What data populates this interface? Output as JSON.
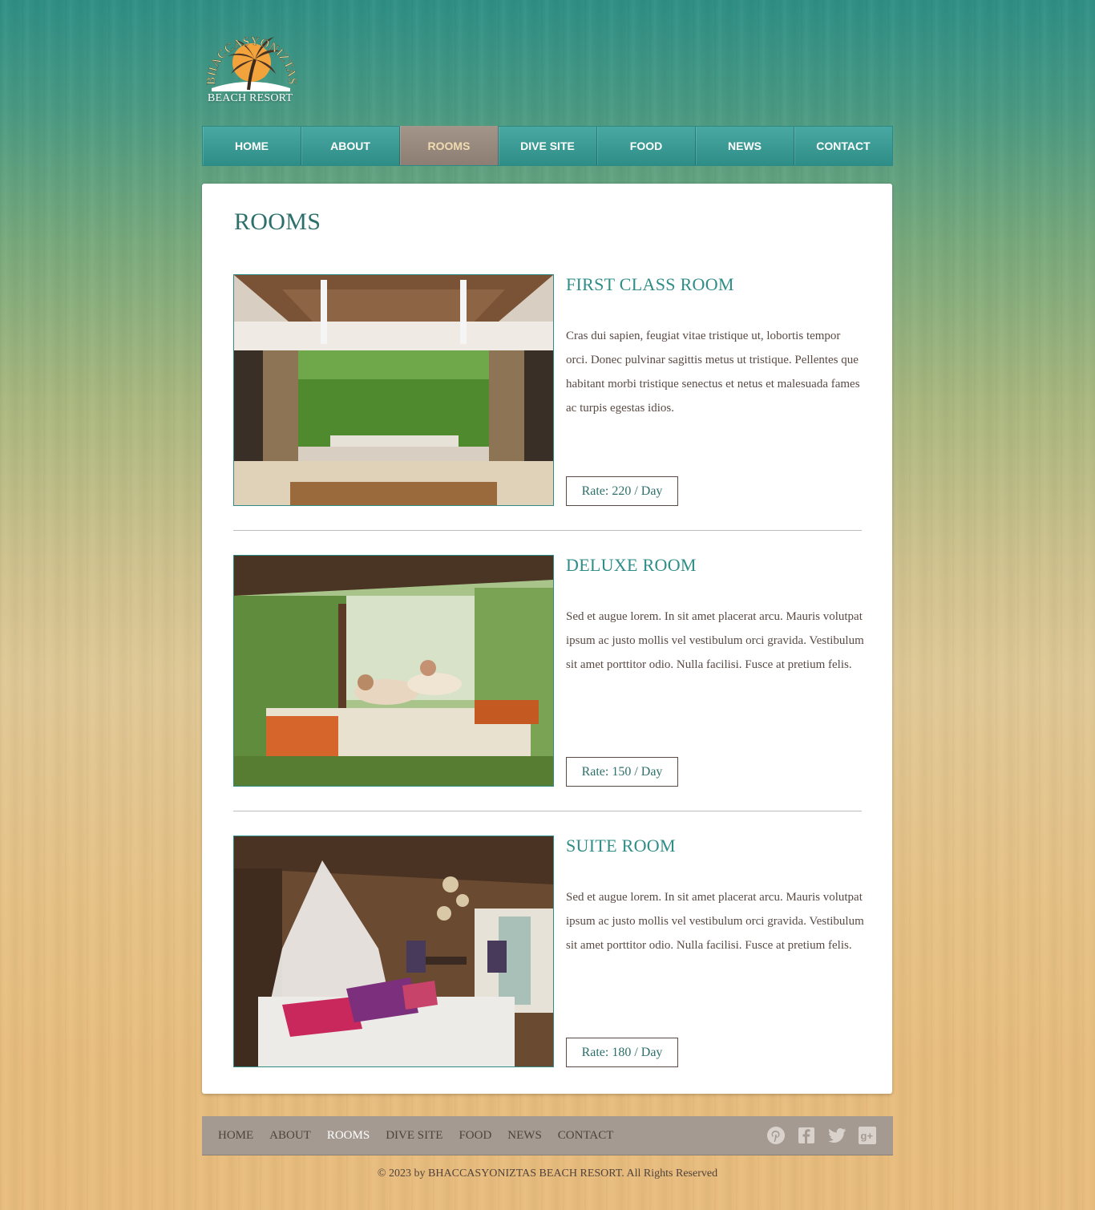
{
  "logo": {
    "arc_text": "BHACCASYONIZTAS",
    "tagline": "BEACH RESORT"
  },
  "nav": {
    "items": [
      {
        "label": "HOME"
      },
      {
        "label": "ABOUT"
      },
      {
        "label": "ROOMS",
        "active": true
      },
      {
        "label": "DIVE SITE"
      },
      {
        "label": "FOOD"
      },
      {
        "label": "NEWS"
      },
      {
        "label": "CONTACT"
      }
    ]
  },
  "page": {
    "title": "ROOMS"
  },
  "rooms": [
    {
      "name": "FIRST CLASS ROOM",
      "description": "Cras dui sapien, feugiat vitae tristique ut, lobortis tempor orci. Donec pulvinar sagittis metus ut tristique. Pellentes que habitant morbi tristique senectus et netus et malesuada fames ac turpis egestas idios.",
      "rate": "Rate: 220 / Day"
    },
    {
      "name": "DELUXE ROOM",
      "description": "Sed et augue lorem. In sit amet placerat arcu. Mauris volutpat ipsum ac justo mollis vel vestibulum orci gravida. Vestibulum sit amet porttitor odio. Nulla facilisi. Fusce at pretium felis.",
      "rate": "Rate: 150 / Day"
    },
    {
      "name": "SUITE ROOM",
      "description": "Sed et augue lorem. In sit amet placerat arcu. Mauris volutpat ipsum ac justo mollis vel vestibulum orci gravida. Vestibulum sit amet porttitor odio. Nulla facilisi. Fusce at pretium felis.",
      "rate": "Rate: 180 / Day"
    }
  ],
  "footer": {
    "nav": [
      {
        "label": "HOME"
      },
      {
        "label": "ABOUT"
      },
      {
        "label": "ROOMS",
        "active": true
      },
      {
        "label": "DIVE SITE"
      },
      {
        "label": "FOOD"
      },
      {
        "label": "NEWS"
      },
      {
        "label": "CONTACT"
      }
    ],
    "social_icons": [
      "pinterest-icon",
      "facebook-icon",
      "twitter-icon",
      "google-plus-icon"
    ],
    "copyright": "© 2023 by BHACCASYONIZTAS BEACH RESORT. All Rights Reserved"
  },
  "colors": {
    "teal_accent": "#2f8d87",
    "nav_active": "#8d7e74",
    "footer_bar": "#a59a91",
    "body_text": "#5a4a44"
  }
}
